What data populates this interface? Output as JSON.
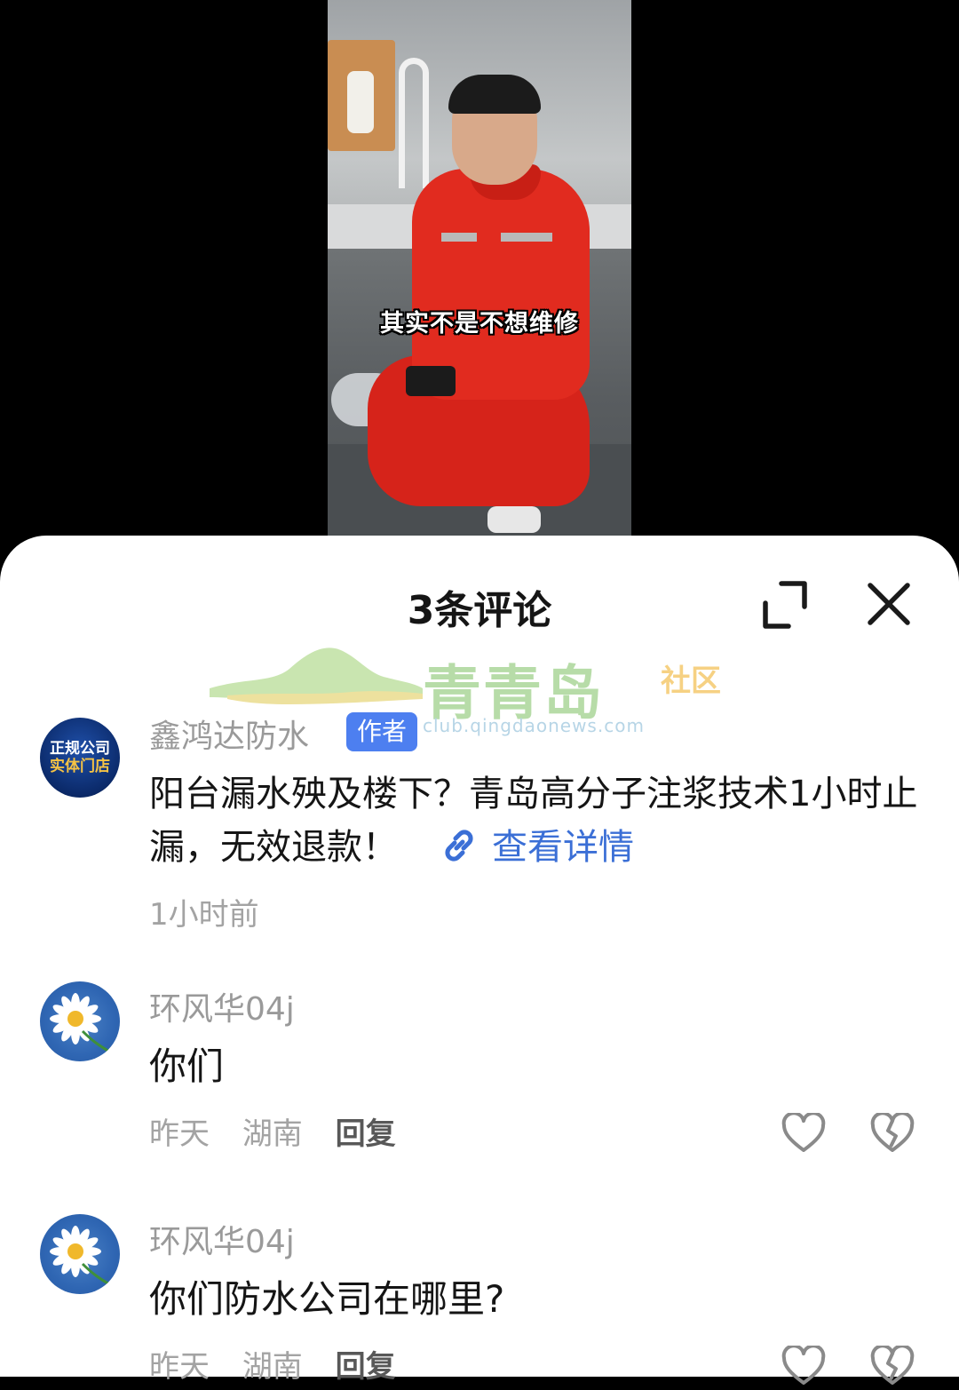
{
  "video": {
    "subtitle": "其实不是不想维修"
  },
  "comments_sheet": {
    "title": "3条评论",
    "icons": {
      "expand": "expand-icon",
      "close": "close-icon"
    }
  },
  "watermark": {
    "name": "青青岛",
    "suffix": "社区",
    "url": "club.qingdaonews.com"
  },
  "comments": [
    {
      "avatar": {
        "line1": "正规公司",
        "line2": "实体门店"
      },
      "author": "鑫鸿达防水",
      "badge": "作者",
      "text": "阳台漏水殃及楼下？青岛高分子注浆技术1小时止漏，无效退款！",
      "link_label": "查看详情",
      "time": "1小时前"
    },
    {
      "author": "环风华04j",
      "text": "你们",
      "time": "昨天",
      "location": "湖南",
      "reply_label": "回复"
    },
    {
      "author": "环风华04j",
      "text": "你们防水公司在哪里?",
      "time": "昨天",
      "location": "湖南",
      "reply_label": "回复"
    }
  ]
}
